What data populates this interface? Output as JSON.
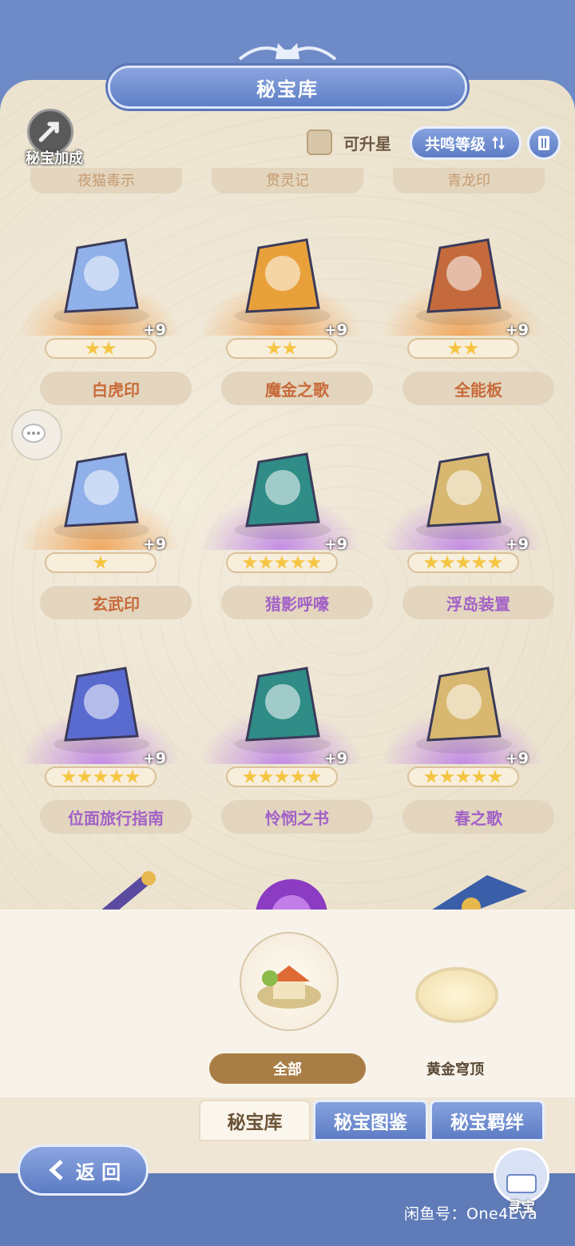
{
  "header": {
    "title": "秘宝库"
  },
  "toolbar": {
    "boost_label": "秘宝加成",
    "upgradable_label": "可升星",
    "sort_label": "共鸣等级"
  },
  "top_partial_items": [
    "夜猫毒示",
    "贯灵记",
    "青龙印"
  ],
  "items": [
    {
      "name": "白虎印",
      "plus": "+9",
      "stars": 2,
      "rarity": "orange"
    },
    {
      "name": "魔金之歌",
      "plus": "+9",
      "stars": 2,
      "rarity": "orange"
    },
    {
      "name": "全能板",
      "plus": "+9",
      "stars": 2,
      "rarity": "orange"
    },
    {
      "name": "玄武印",
      "plus": "+9",
      "stars": 1,
      "rarity": "orange"
    },
    {
      "name": "猎影呼嚎",
      "plus": "+9",
      "stars": 5,
      "rarity": "purple"
    },
    {
      "name": "浮岛装置",
      "plus": "+9",
      "stars": 5,
      "rarity": "purple"
    },
    {
      "name": "位面旅行指南",
      "plus": "+9",
      "stars": 5,
      "rarity": "purple"
    },
    {
      "name": "怜悯之书",
      "plus": "+9",
      "stars": 5,
      "rarity": "purple"
    },
    {
      "name": "春之歌",
      "plus": "+9",
      "stars": 5,
      "rarity": "purple"
    }
  ],
  "categories": {
    "all_label": "全部",
    "golden_label": "黄金穹顶"
  },
  "tabs": [
    "秘宝库",
    "秘宝图鉴",
    "秘宝羁绊"
  ],
  "footer": {
    "back_label": "返 回",
    "hunt_label": "寻宝"
  },
  "watermark": "闲鱼号：One4Eva",
  "colors": {
    "accent_blue": "#6f8cc8",
    "orange_name": "#c86a3a",
    "purple_name": "#a261c7",
    "star": "#f5c542"
  }
}
